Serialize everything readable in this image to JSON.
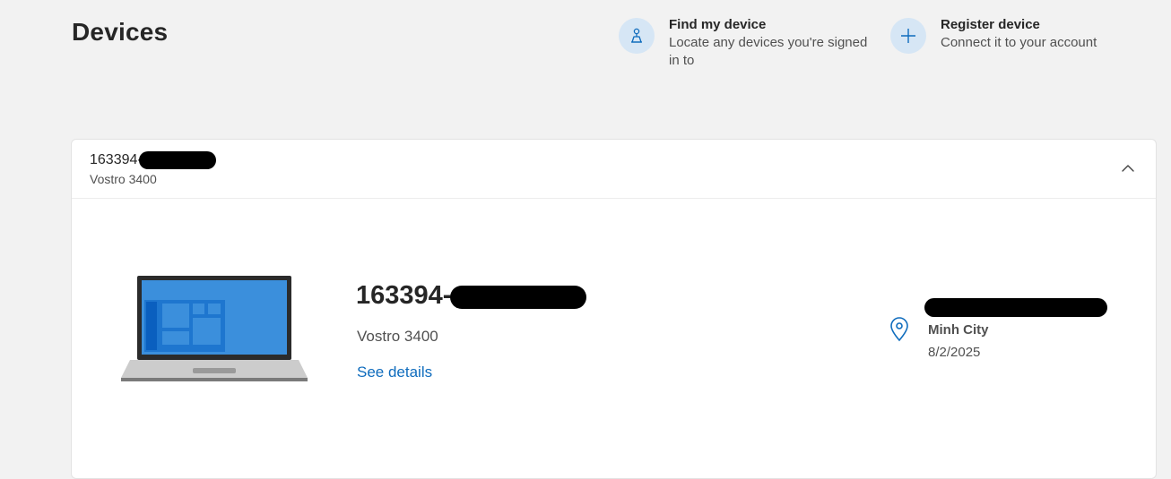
{
  "page": {
    "title": "Devices"
  },
  "actions": {
    "find": {
      "title": "Find my device",
      "description": "Locate any devices you're signed in to",
      "icon": "find-device-icon"
    },
    "register": {
      "title": "Register device",
      "description": "Connect it to your account",
      "icon": "plus-icon"
    }
  },
  "device": {
    "id_prefix": "163394-",
    "model": "Vostro 3400",
    "see_details": "See details",
    "location": {
      "city": "Minh City",
      "date": "8/2/2025"
    }
  },
  "colors": {
    "accent": "#0f6cbd",
    "icon_circle_bg": "#d6e6f5",
    "background": "#f2f2f2"
  }
}
